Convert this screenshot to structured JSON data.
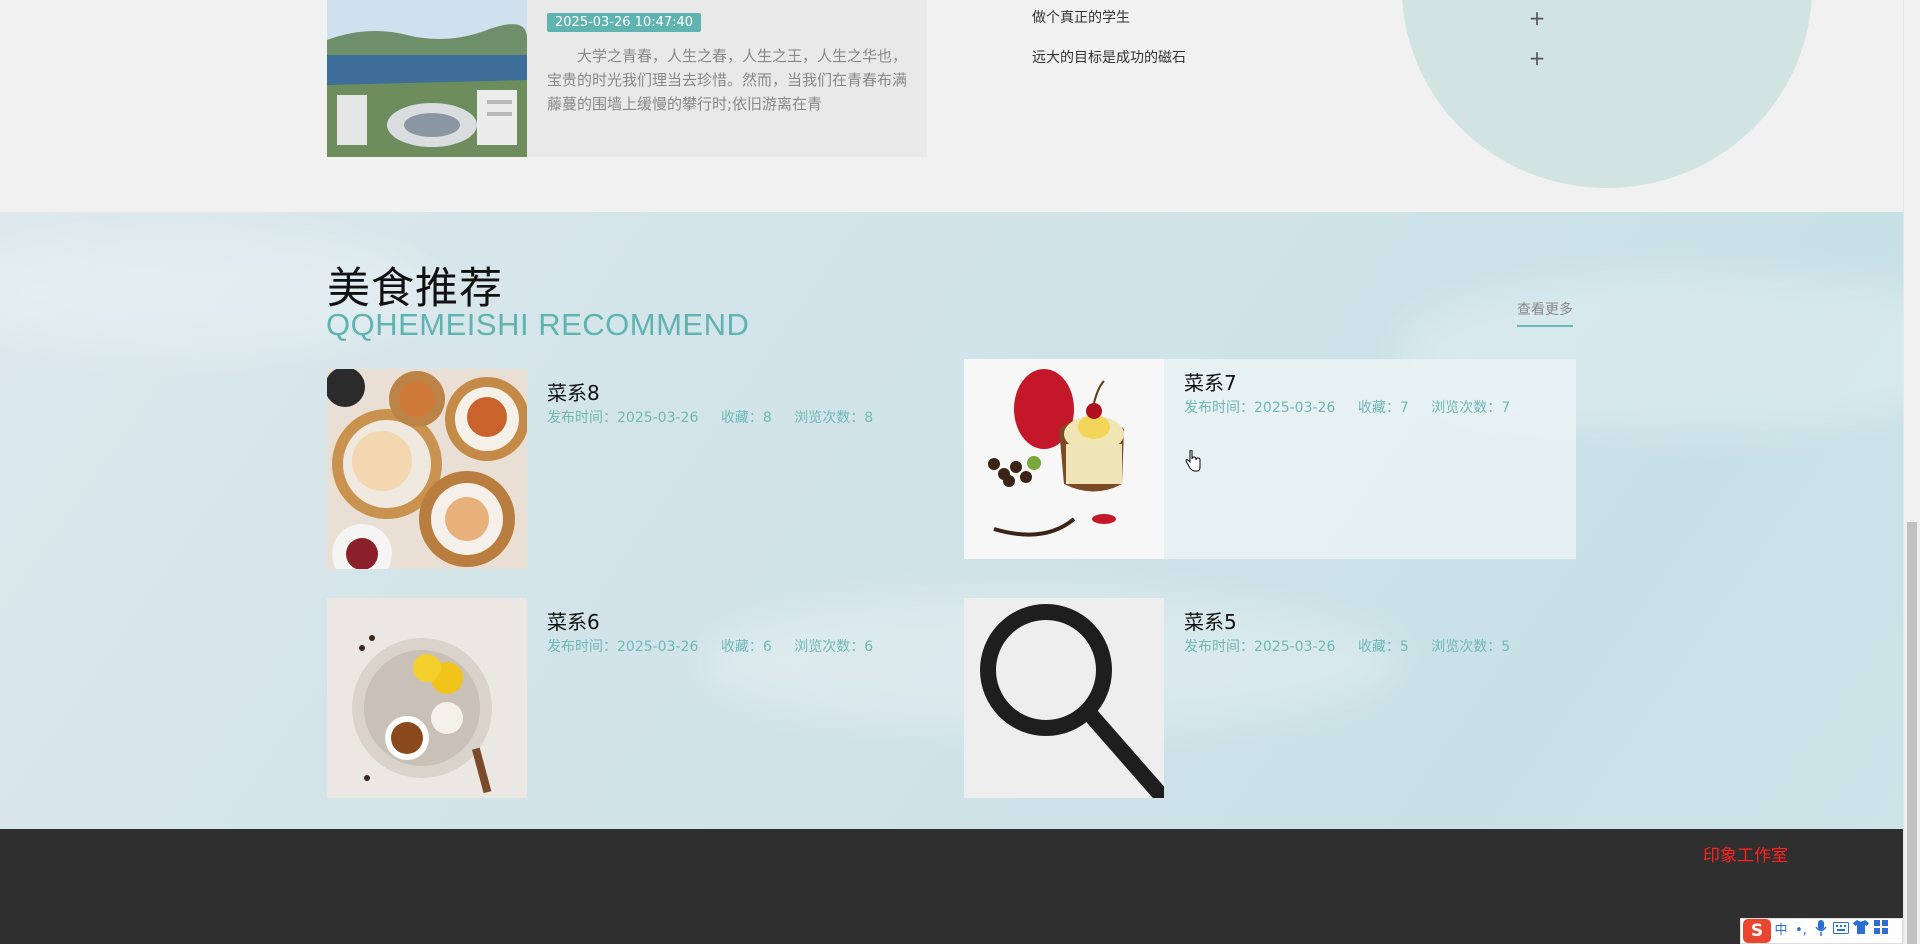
{
  "news": {
    "date": "2025-03-26 10:47:40",
    "excerpt": "大学之青春，人生之春，人生之王，人生之华也，宝贵的时光我们理当去珍惜。然而，当我们在青春布满藤蔓的围墙上缓慢的攀行时;依旧游离在青"
  },
  "faq": [
    {
      "question": "做个真正的学生",
      "toggle": "+"
    },
    {
      "question": "远大的目标是成功的磁石",
      "toggle": "+"
    }
  ],
  "food_section": {
    "title": "美食推荐",
    "subtitle": "QQHEMEISHI RECOMMEND",
    "more_label": "查看更多",
    "items": [
      {
        "name": "菜系8",
        "publish": "发布时间：2025-03-26",
        "favorites": "收藏：8",
        "views": "浏览次数：8",
        "image": "dim-sum-photo"
      },
      {
        "name": "菜系7",
        "publish": "发布时间：2025-03-26",
        "favorites": "收藏：7",
        "views": "浏览次数：7",
        "image": "dessert-photo"
      },
      {
        "name": "菜系6",
        "publish": "发布时间：2025-03-26",
        "favorites": "收藏：6",
        "views": "浏览次数：6",
        "image": "lemon-tea-photo"
      },
      {
        "name": "菜系5",
        "publish": "发布时间：2025-03-26",
        "favorites": "收藏：5",
        "views": "浏览次数：5",
        "image": "magnifier-placeholder"
      }
    ]
  },
  "footer": {
    "brand": "印象工作室"
  },
  "ime": {
    "logo": "S",
    "lang": "中",
    "punct": "•,",
    "icons": [
      "mic-icon",
      "keyboard-icon",
      "shirt-icon",
      "grid-icon"
    ]
  },
  "colors": {
    "accent": "#5fb3b0",
    "footer_bg": "#2f2f2f",
    "brand_red": "#ff2020"
  }
}
